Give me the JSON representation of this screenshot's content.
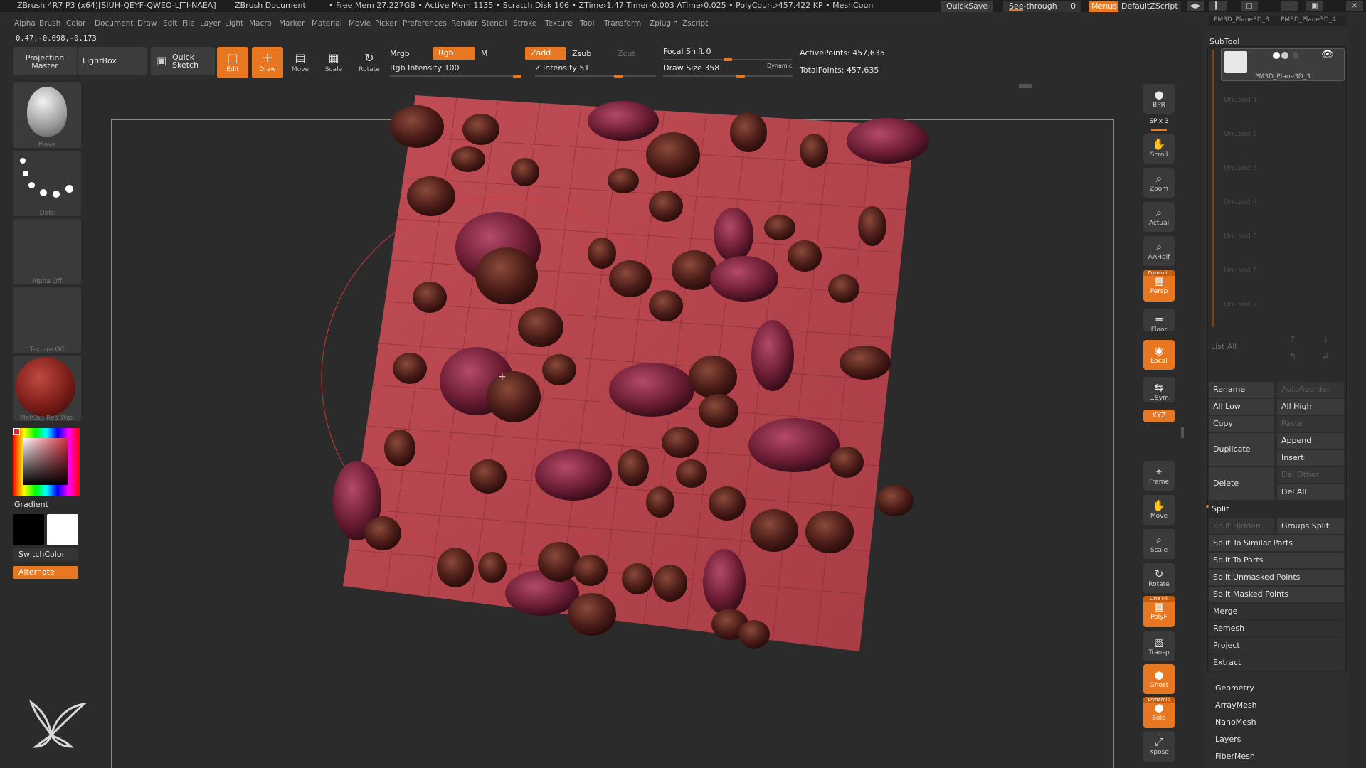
{
  "titlebar": {
    "app": "ZBrush 4R7 P3 (x64)[SIUH-QEYF-QWEO-LJTI-NAEA]",
    "doc": "ZBrush Document",
    "stats": "• Free Mem 27.227GB • Active Mem 1135 • Scratch Disk 106 • ZTime›1.47 Timer›0.003 ATime›0.025 • PolyCount›457.422 KP • MeshCoun",
    "quicksave": "QuickSave",
    "seethrough": "See-through",
    "seethrough_value": "0",
    "menus": "Menus",
    "defaultzscript": "DefaultZScript",
    "window_buttons": [
      "◀▶",
      "▎",
      "□",
      "–",
      "▣",
      "✕"
    ]
  },
  "menus_tabs": [
    "PM3D_Plane3D_3",
    "PM3D_Plane3D_4"
  ],
  "menubar": [
    "Alpha",
    "Brush",
    "Color",
    "Document",
    "Draw",
    "Edit",
    "File",
    "Layer",
    "Light",
    "Macro",
    "Marker",
    "Material",
    "Movie",
    "Picker",
    "Preferences",
    "Render",
    "Stencil",
    "Stroke",
    "Texture",
    "Tool",
    "Transform",
    "Zplugin",
    "Zscript"
  ],
  "coords": "0.47,-0.098,-0.173",
  "shelf": {
    "projection_master": "Projection\nMaster",
    "lightbox": "LightBox",
    "quick_sketch": "Quick\nSketch",
    "edit": "Edit",
    "draw": "Draw",
    "move": "Move",
    "scale": "Scale",
    "rotate": "Rotate",
    "mrgb": "Mrgb",
    "rgb": "Rgb",
    "m": "M",
    "zadd": "Zadd",
    "zsub": "Zsub",
    "zcut": "Zcut",
    "rgb_intensity": "Rgb Intensity 100",
    "z_intensity": "Z Intensity 51",
    "focal_shift": "Focal Shift 0",
    "draw_size": "Draw Size 358",
    "dynamic": "Dynamic",
    "active_points": "ActivePoints: 457,635",
    "total_points": "TotalPoints: 457,635"
  },
  "left_panel": {
    "brush_label": "Move",
    "stroke_label": "Dots",
    "alpha_label": "Alpha Off",
    "texture_label": "Texture Off",
    "material_label": "MatCap Red Wax",
    "gradient": "Gradient",
    "switch_color": "SwitchColor",
    "alternate": "Alternate"
  },
  "right_toolbar": [
    {
      "name": "bpr",
      "label": "BPR",
      "glyph": "●",
      "orange": false
    },
    {
      "name": "scroll",
      "label": "Scroll",
      "glyph": "✋",
      "orange": false
    },
    {
      "name": "zoom",
      "label": "Zoom",
      "glyph": "⌕",
      "orange": false
    },
    {
      "name": "actual",
      "label": "Actual",
      "glyph": "⌕",
      "orange": false
    },
    {
      "name": "aahalf",
      "label": "AAHalf",
      "glyph": "⌕",
      "orange": false
    },
    {
      "name": "persp",
      "label": "Persp",
      "glyph": "▦",
      "orange": true,
      "sup": "Dynamic"
    },
    {
      "name": "floor",
      "label": "Floor",
      "glyph": "═",
      "orange": false
    },
    {
      "name": "local",
      "label": "Local",
      "glyph": "◉",
      "orange": true
    },
    {
      "name": "lsym",
      "label": "L.Sym",
      "glyph": "⇆",
      "orange": false
    },
    {
      "name": "frame",
      "label": "Frame",
      "glyph": "⌖",
      "orange": false
    },
    {
      "name": "move",
      "label": "Move",
      "glyph": "✋",
      "orange": false
    },
    {
      "name": "scale",
      "label": "Scale",
      "glyph": "⌕",
      "orange": false
    },
    {
      "name": "rotate",
      "label": "Rotate",
      "glyph": "↻",
      "orange": false
    },
    {
      "name": "polyf",
      "label": "PolyF",
      "glyph": "▦",
      "orange": true,
      "sup": "Line Fill"
    },
    {
      "name": "transp",
      "label": "Transp",
      "glyph": "▧",
      "orange": false
    },
    {
      "name": "ghost",
      "label": "Ghost",
      "glyph": "●",
      "orange": true
    },
    {
      "name": "solo",
      "label": "Solo",
      "glyph": "●",
      "orange": true,
      "sup": "Dynamic"
    },
    {
      "name": "xpose",
      "label": "Xpose",
      "glyph": "⤢",
      "orange": false
    }
  ],
  "spix": "SPix 3",
  "xyz": "XYZ",
  "subtool": {
    "header": "SubTool",
    "active_name": "PM3D_Plane3D_3",
    "unused_slots": [
      "Unused 1",
      "Unused 2",
      "Unused 3",
      "Unused 4",
      "Unused 5",
      "Unused 6",
      "Unused 7"
    ],
    "list_all": "List All",
    "rename": "Rename",
    "auto_reorder": "AutoReorder",
    "all_low": "All Low",
    "all_high": "All High",
    "copy": "Copy",
    "paste": "Paste",
    "duplicate": "Duplicate",
    "append": "Append",
    "insert": "Insert",
    "delete": "Delete",
    "del_other": "Del Other",
    "del_all": "Del All",
    "split": "Split",
    "split_hidden": "Split Hidden",
    "groups_split": "Groups Split",
    "split_similar": "Split To Similar Parts",
    "split_parts": "Split To Parts",
    "split_unmasked": "Split Unmasked Points",
    "split_masked": "Split Masked Points",
    "merge": "Merge",
    "remesh": "Remesh",
    "project": "Project",
    "extract": "Extract"
  },
  "sections": [
    "Geometry",
    "ArrayMesh",
    "NanoMesh",
    "Layers",
    "FiberMesh"
  ],
  "colors": {
    "accent": "#e87722",
    "plane": "#b8464e",
    "rock": "#4a1c18"
  }
}
